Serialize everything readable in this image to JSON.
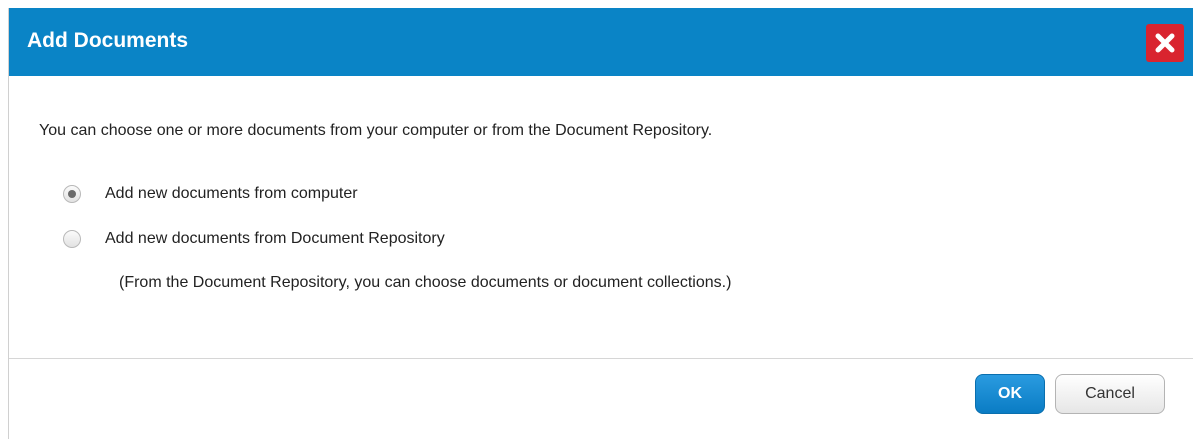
{
  "dialog": {
    "title": "Add Documents",
    "close_icon": "close-x-icon",
    "description": "You can choose one or more documents from your computer or from the Document Repository.",
    "options": [
      {
        "label": "Add new documents from computer",
        "selected": true
      },
      {
        "label": "Add new documents from Document Repository",
        "selected": false
      }
    ],
    "note": "(From the Document Repository, you can choose documents or document collections.)",
    "buttons": {
      "ok_label": "OK",
      "cancel_label": "Cancel"
    }
  },
  "colors": {
    "titlebar": "#0a84c6",
    "close_button": "#d9242f",
    "ok_button": "#0a7cc4"
  }
}
